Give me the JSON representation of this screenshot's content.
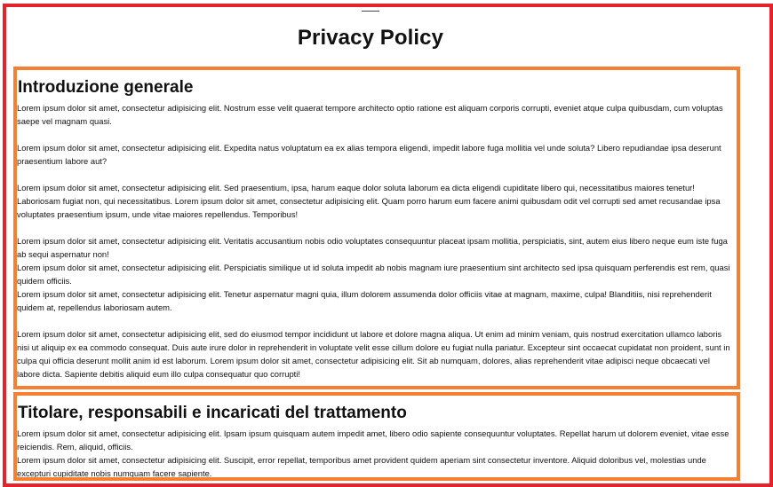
{
  "page": {
    "title": "Privacy Policy"
  },
  "sections": [
    {
      "heading": "Introduzione generale",
      "paragraphs": [
        "Lorem ipsum dolor sit amet, consectetur adipisicing elit. Nostrum esse velit quaerat tempore architecto optio ratione est aliquam corporis corrupti, eveniet atque culpa quibusdam, cum voluptas saepe vel magnam quasi.",
        "Lorem ipsum dolor sit amet, consectetur adipisicing elit. Expedita natus voluptatum ea ex alias tempora eligendi, impedit labore fuga mollitia vel unde soluta? Libero repudiandae ipsa deserunt praesentium labore aut?",
        "Lorem ipsum dolor sit amet, consectetur adipisicing elit. Sed praesentium, ipsa, harum eaque dolor soluta laborum ea dicta eligendi cupiditate libero qui, necessitatibus maiores tenetur! Laboriosam fugiat non, qui necessitatibus. Lorem ipsum dolor sit amet, consectetur adipisicing elit. Quam porro harum eum facere animi quibusdam odit vel corrupti sed amet recusandae ipsa voluptates praesentium ipsum, unde vitae maiores repellendus. Temporibus!",
        "Lorem ipsum dolor sit amet, consectetur adipisicing elit. Veritatis accusantium nobis odio voluptates consequuntur placeat ipsam mollitia, perspiciatis, sint, autem eius libero neque eum iste fuga ab sequi aspernatur non!",
        "Lorem ipsum dolor sit amet, consectetur adipisicing elit. Perspiciatis similique ut id soluta impedit ab nobis magnam iure praesentium sint architecto sed ipsa quisquam perferendis est rem, quasi quidem officiis.",
        "Lorem ipsum dolor sit amet, consectetur adipisicing elit. Tenetur aspernatur magni quia, illum dolorem assumenda dolor officiis vitae at magnam, maxime, culpa! Blanditiis, nisi reprehenderit quidem at, repellendus laboriosam autem.",
        "Lorem ipsum dolor sit amet, consectetur adipisicing elit, sed do eiusmod tempor incididunt ut labore et dolore magna aliqua. Ut enim ad minim veniam, quis nostrud exercitation ullamco laboris nisi ut aliquip ex ea commodo consequat. Duis aute irure dolor in reprehenderit in voluptate velit esse cillum dolore eu fugiat nulla pariatur. Excepteur sint occaecat cupidatat non proident, sunt in culpa qui officia deserunt mollit anim id est laborum. Lorem ipsum dolor sit amet, consectetur adipisicing elit. Sit ab numquam, dolores, alias reprehenderit vitae adipisci neque obcaecati vel labore dicta. Sapiente debitis aliquid eum illo culpa consequatur quo corrupti!"
      ]
    },
    {
      "heading": "Titolare, responsabili e incaricati del trattamento",
      "paragraphs": [
        "Lorem ipsum dolor sit amet, consectetur adipisicing elit. Ipsam ipsum quisquam autem impedit amet, libero odio sapiente consequuntur voluptates. Repellat harum ut dolorem eveniet, vitae esse reiciendis. Rem, aliquid, officiis.",
        "Lorem ipsum dolor sit amet, consectetur adipisicing elit. Suscipit, error repellat, temporibus amet provident quidem aperiam sint consectetur inventore. Aliquid doloribus vel, molestias unde excepturi cupiditate nobis numquam facere sapiente."
      ]
    }
  ],
  "colors": {
    "frame": "#e3222a",
    "section_border": "#f58033",
    "text": "#111111"
  }
}
